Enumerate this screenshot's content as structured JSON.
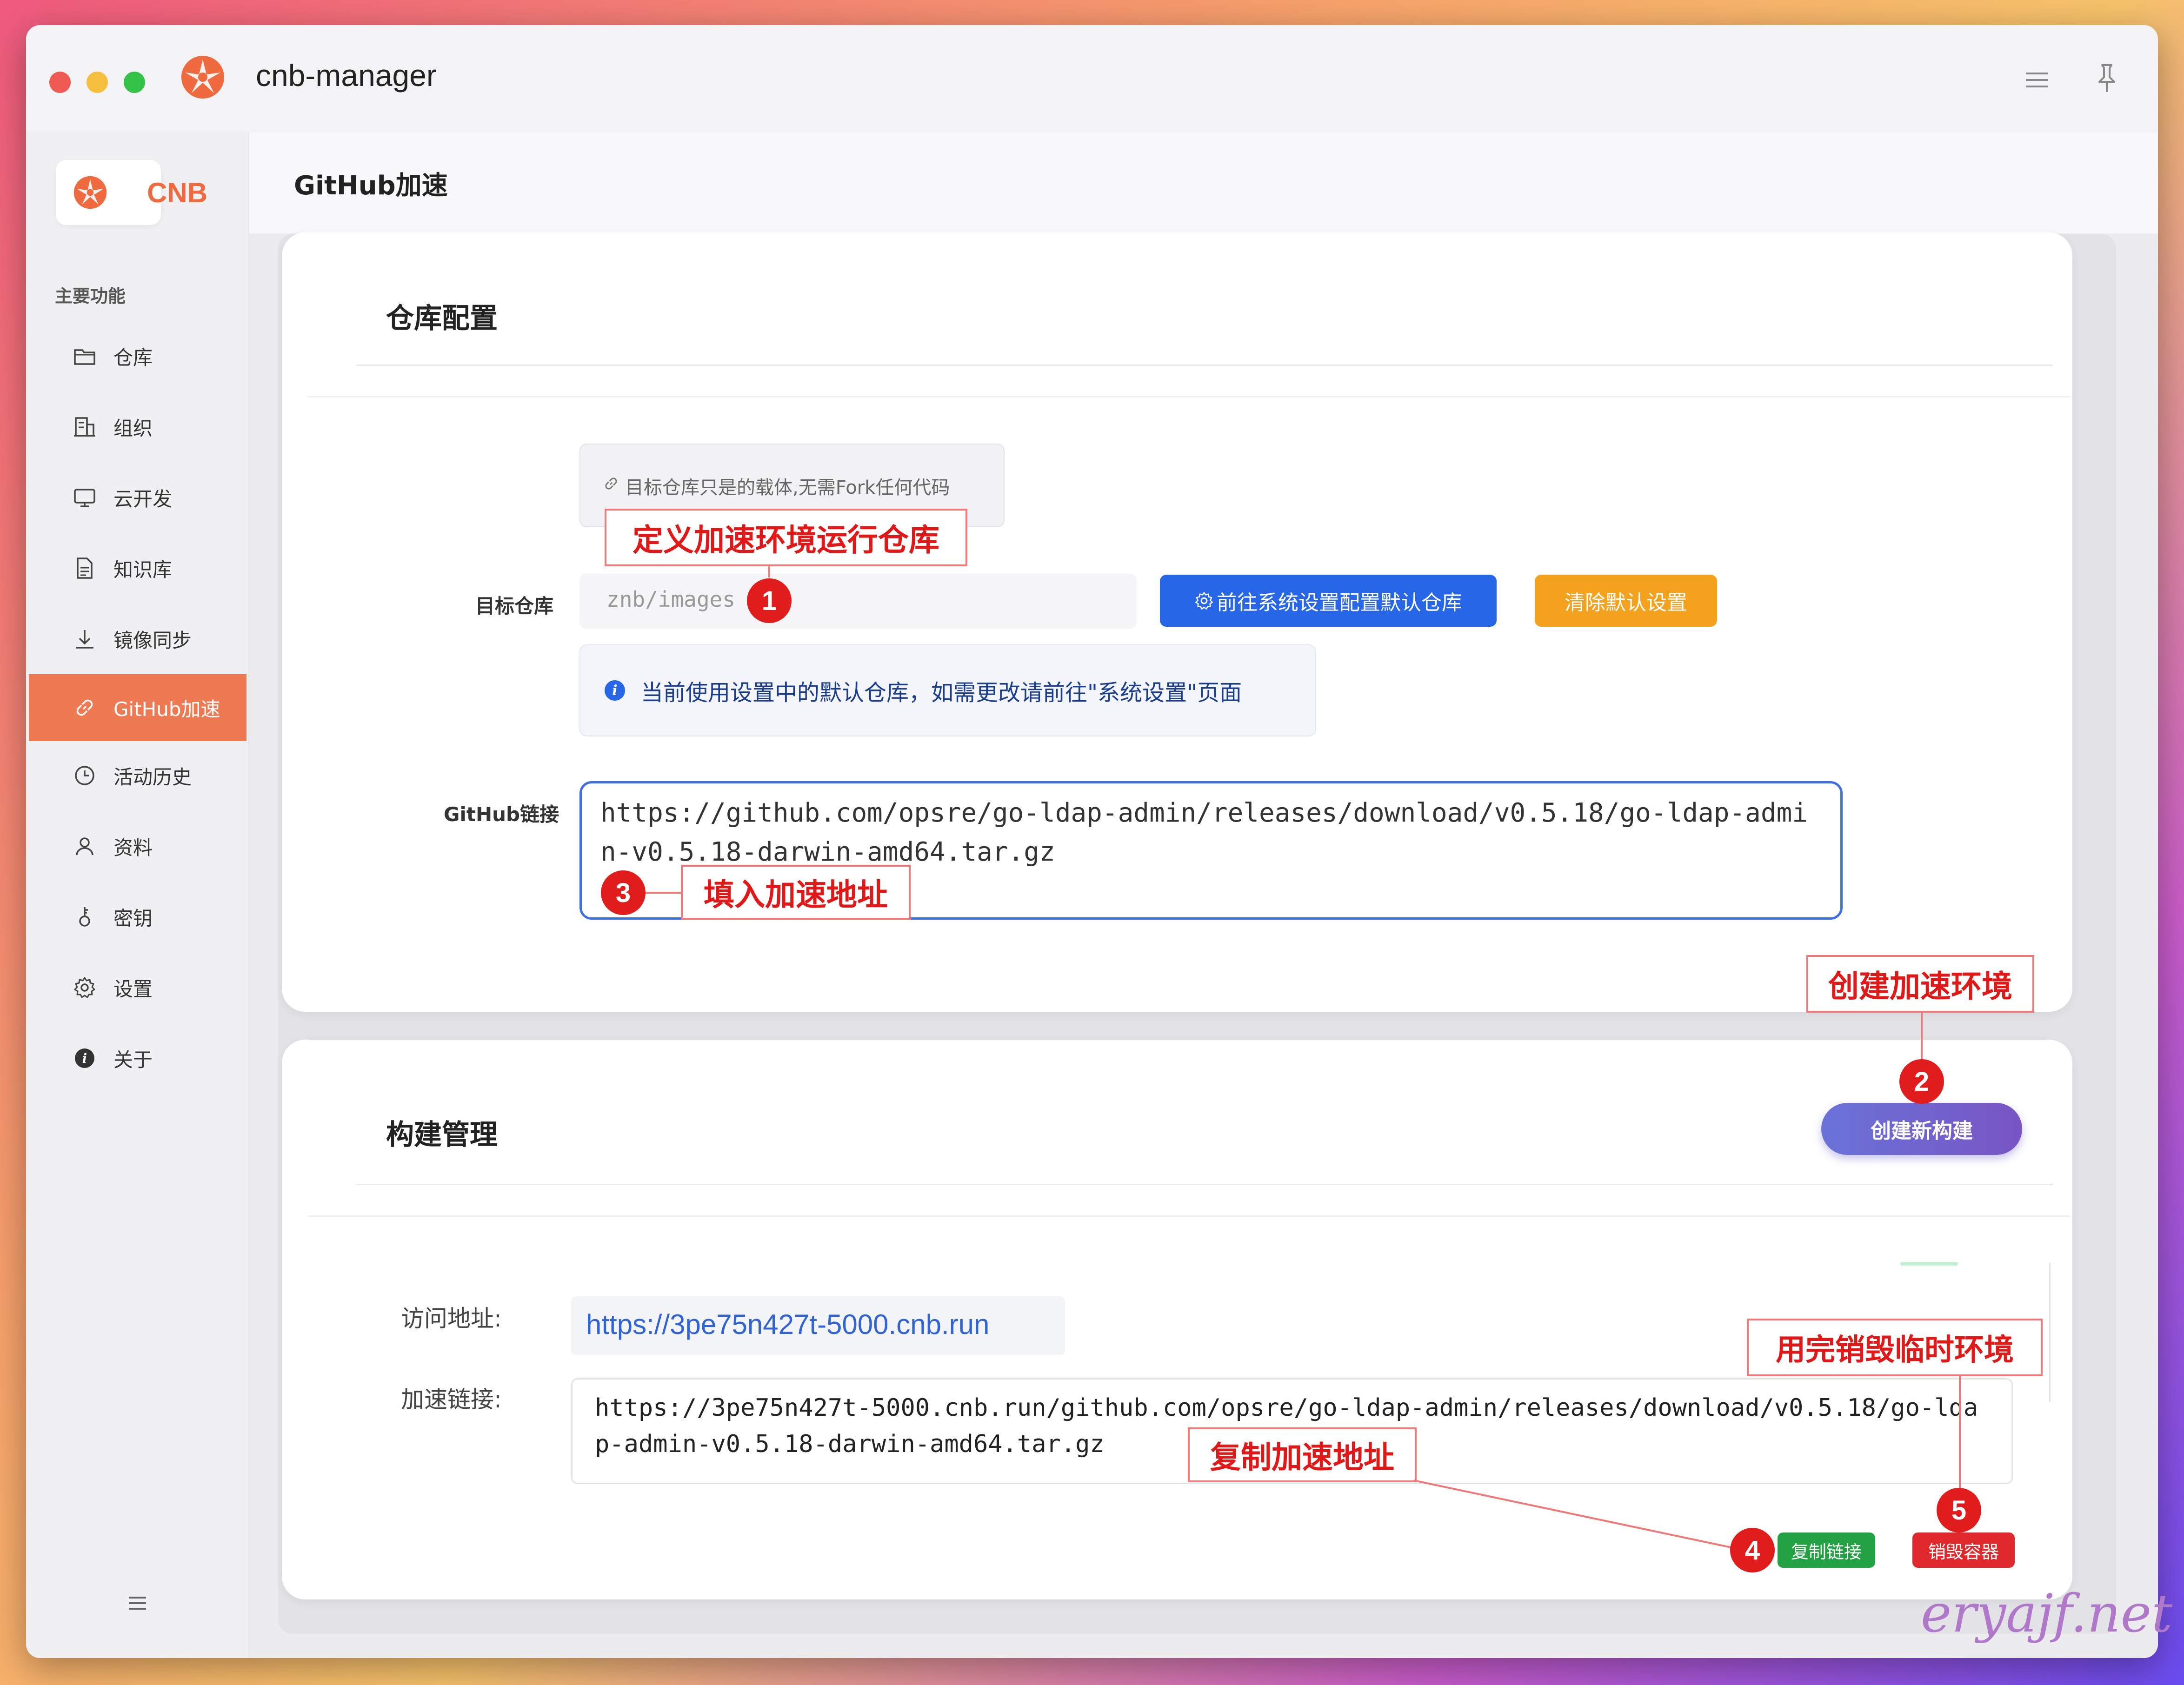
{
  "window": {
    "title": "cnb-manager"
  },
  "sidebar": {
    "brand": "CNB",
    "section": "主要功能",
    "items": [
      {
        "label": "仓库",
        "icon": "folder-icon"
      },
      {
        "label": "组织",
        "icon": "building-icon"
      },
      {
        "label": "云开发",
        "icon": "monitor-icon"
      },
      {
        "label": "知识库",
        "icon": "document-icon"
      },
      {
        "label": "镜像同步",
        "icon": "download-icon"
      },
      {
        "label": "GitHub加速",
        "icon": "link-icon",
        "active": true
      },
      {
        "label": "活动历史",
        "icon": "clock-icon"
      },
      {
        "label": "资料",
        "icon": "user-icon"
      },
      {
        "label": "密钥",
        "icon": "key-icon"
      },
      {
        "label": "设置",
        "icon": "gear-icon"
      },
      {
        "label": "关于",
        "icon": "info-icon"
      }
    ]
  },
  "header": {
    "title": "GitHub加速"
  },
  "repo_config": {
    "title": "仓库配置",
    "hint": "目标仓库只是的载体,无需Fork任何代码",
    "target_label": "目标仓库",
    "target_placeholder": "znb/images",
    "goto_settings_button": "前往系统设置配置默认仓库",
    "clear_default_button": "清除默认设置",
    "info_text": "当前使用设置中的默认仓库，如需更改请前往\"系统设置\"页面",
    "github_label": "GitHub链接",
    "github_url": "https://github.com/opsre/go-ldap-admin/releases/download/v0.5.18/go-ldap-admin-v0.5.18-darwin-amd64.tar.gz"
  },
  "build_mgmt": {
    "title": "构建管理",
    "new_build_button": "创建新构建",
    "visit_label": "访问地址:",
    "visit_url": "https://3pe75n427t-5000.cnb.run",
    "accel_label": "加速链接:",
    "accel_url": "https://3pe75n427t-5000.cnb.run/github.com/opsre/go-ldap-admin/releases/download/v0.5.18/go-ldap-admin-v0.5.18-darwin-amd64.tar.gz",
    "copy_button": "复制链接",
    "destroy_button": "销毁容器"
  },
  "annotations": {
    "a1": "定义加速环境运行仓库",
    "a2": "创建加速环境",
    "a3": "填入加速地址",
    "a4": "复制加速地址",
    "a5": "用完销毁临时环境",
    "n1": "1",
    "n2": "2",
    "n3": "3",
    "n4": "4",
    "n5": "5"
  },
  "watermark": "eryajf.net",
  "colors": {
    "accent": "#ee7a53",
    "primary_blue": "#2866e8",
    "warning_orange": "#f4a11d",
    "success_green": "#23a244",
    "danger_red": "#e0292c",
    "annotation_red": "#e11c1c"
  }
}
